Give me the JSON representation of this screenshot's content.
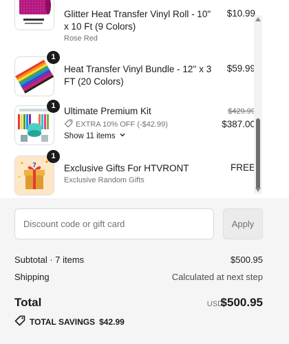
{
  "items": [
    {
      "title": "Glitter Heat Transfer Vinyl Roll - 10\" x 10 Ft (9 Colors)",
      "variant": "Rose Red",
      "price": "$10.99",
      "image_icon": "glitter-vinyl-roll-image"
    },
    {
      "qty": "1",
      "title": "Heat Transfer Vinyl Bundle - 12'' x 3 FT (20 Colors)",
      "price": "$59.99",
      "image_icon": "vinyl-bundle-image"
    },
    {
      "qty": "1",
      "title": "Ultimate Premium Kit",
      "discount": "EXTRA 10% OFF (-$42.99)",
      "original_price": "$429.99",
      "price": "$387.00",
      "show_items": "Show 11 items",
      "image_icon": "premium-kit-image"
    },
    {
      "qty": "1",
      "title": "Exclusive Gifts For HTVRONT",
      "variant": "Exclusive Random Gifts",
      "price": "FREE",
      "image_icon": "gift-box-image"
    }
  ],
  "discount": {
    "placeholder": "Discount code or gift card",
    "apply_label": "Apply"
  },
  "summary": {
    "subtotal_label": "Subtotal · 7 items",
    "subtotal_value": "$500.95",
    "shipping_label": "Shipping",
    "shipping_value": "Calculated at next step",
    "total_label": "Total",
    "currency": "USD",
    "total_value": "$500.95",
    "savings_label": "TOTAL SAVINGS",
    "savings_value": "$42.99"
  },
  "colors": {
    "panel_bg": "#f5f5f5",
    "badge_bg": "#1a1a1a",
    "muted_text": "#707070"
  }
}
